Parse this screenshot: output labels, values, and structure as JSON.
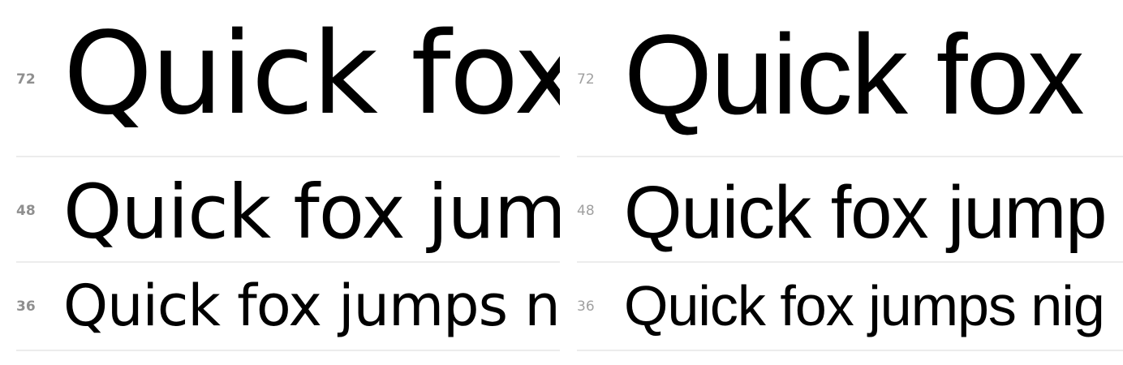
{
  "specimens": [
    {
      "rows": [
        {
          "size": "72",
          "text": "Quick fox"
        },
        {
          "size": "48",
          "text": "Quick fox jump"
        },
        {
          "size": "36",
          "text": "Quick fox jumps nig"
        }
      ]
    },
    {
      "rows": [
        {
          "size": "72",
          "text": "Quick fox"
        },
        {
          "size": "48",
          "text": "Quick fox jump"
        },
        {
          "size": "36",
          "text": "Quick fox jumps nig"
        }
      ]
    }
  ],
  "colors": {
    "label": "#8f8f8f",
    "divider": "#ececec",
    "text": "#000000"
  }
}
